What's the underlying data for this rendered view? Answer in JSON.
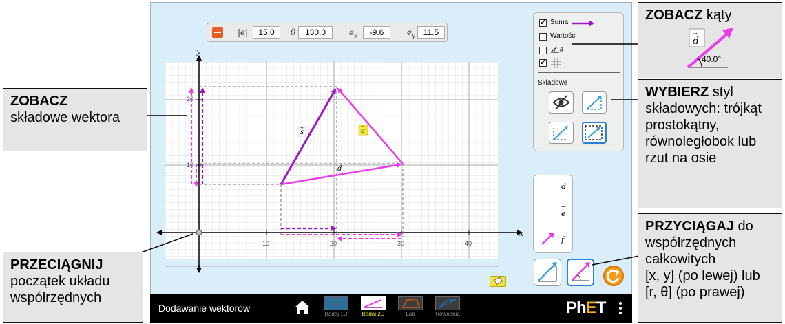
{
  "app": {
    "title": "Dodawanie wektorów",
    "brand": "PhET",
    "screens": [
      {
        "label": "Badaj 1D",
        "active": false
      },
      {
        "label": "Badaj 2D",
        "active": true
      },
      {
        "label": "Lab",
        "active": false
      },
      {
        "label": "Równania",
        "active": false
      }
    ]
  },
  "inspect": {
    "magnitude_label": "|e|",
    "magnitude": "15.0",
    "angle_label": "θ",
    "angle": "130.0",
    "ex_label": "e",
    "ex_sub": "x",
    "ex": "-9.6",
    "ey_label": "e",
    "ey_sub": "y",
    "ey": "11.5"
  },
  "panel": {
    "sum_label": "Suma",
    "sum_checked": true,
    "values_label": "Wartości",
    "values_checked": false,
    "angle_label": "θ",
    "angle_checked": false,
    "grid_checked": true,
    "components_label": "Składowe"
  },
  "graph": {
    "x_axis": "x",
    "y_axis": "y",
    "x_ticks": [
      "10",
      "20",
      "30",
      "40"
    ],
    "y_ticks": [
      "10",
      "20"
    ],
    "vectors": [
      {
        "name": "s",
        "label": "s"
      },
      {
        "name": "e",
        "label": "e"
      },
      {
        "name": "d",
        "label": "d"
      }
    ]
  },
  "toolbox": {
    "vectors": [
      "d",
      "e",
      "f"
    ]
  },
  "colors": {
    "sum": "#9b17c9",
    "vector": "#ec3ce9",
    "component": "#ec3ce9",
    "sum_component": "#9b17c9",
    "panel_bg": "#daeefa"
  },
  "callouts": {
    "view_components": {
      "title": "ZOBACZ",
      "text": "składowe wektora"
    },
    "drag_origin": {
      "title": "PRZECIĄGNIJ",
      "text": "początek układu współrzędnych"
    },
    "view_angles": {
      "title": "ZOBACZ",
      "text": "kąty",
      "vector": "d",
      "angle": "40.0°"
    },
    "choose_style": {
      "title": "WYBIERZ",
      "text": "styl składowych: trójkąt prostokątny, równoległobok lub rzut na osie"
    },
    "snap": {
      "title": "PRZYCIĄGAJ",
      "text1": "do współrzędnych całkowitych",
      "text2": "[x, y] (po lewej) lub",
      "text3": "[r, θ] (po prawej)"
    }
  }
}
